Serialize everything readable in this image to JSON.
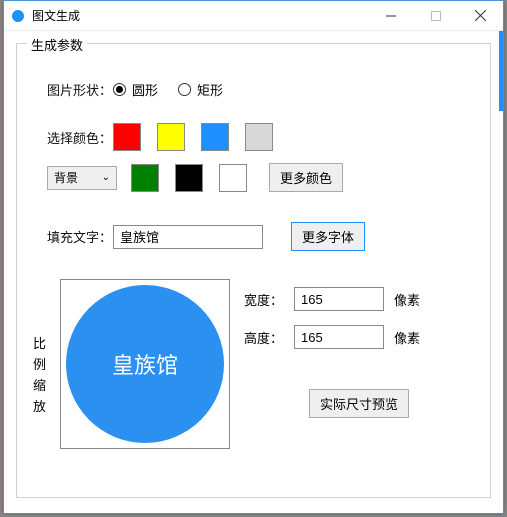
{
  "window": {
    "title": "图文生成"
  },
  "group": {
    "title": "生成参数"
  },
  "shape": {
    "label": "图片形状：",
    "option_circle": "圆形",
    "option_rect": "矩形",
    "selected": "circle"
  },
  "color": {
    "label": "选择颜色：",
    "row1": [
      "#ff0000",
      "#ffff00",
      "#1e90ff",
      "#d8d8d8"
    ],
    "dropdown_label": "背景",
    "row2": [
      "#008000",
      "#000000",
      "#ffffff"
    ],
    "more_colors_label": "更多颜色"
  },
  "text": {
    "label": "填充文字：",
    "value": "皇族馆",
    "more_fonts_label": "更多字体"
  },
  "scale_label_chars": [
    "比",
    "例",
    "缩",
    "放"
  ],
  "preview_text": "皇族馆",
  "dimensions": {
    "width_label": "宽度：",
    "width_value": "165",
    "height_label": "高度：",
    "height_value": "165",
    "unit": "像素",
    "actual_preview_label": "实际尺寸预览"
  }
}
